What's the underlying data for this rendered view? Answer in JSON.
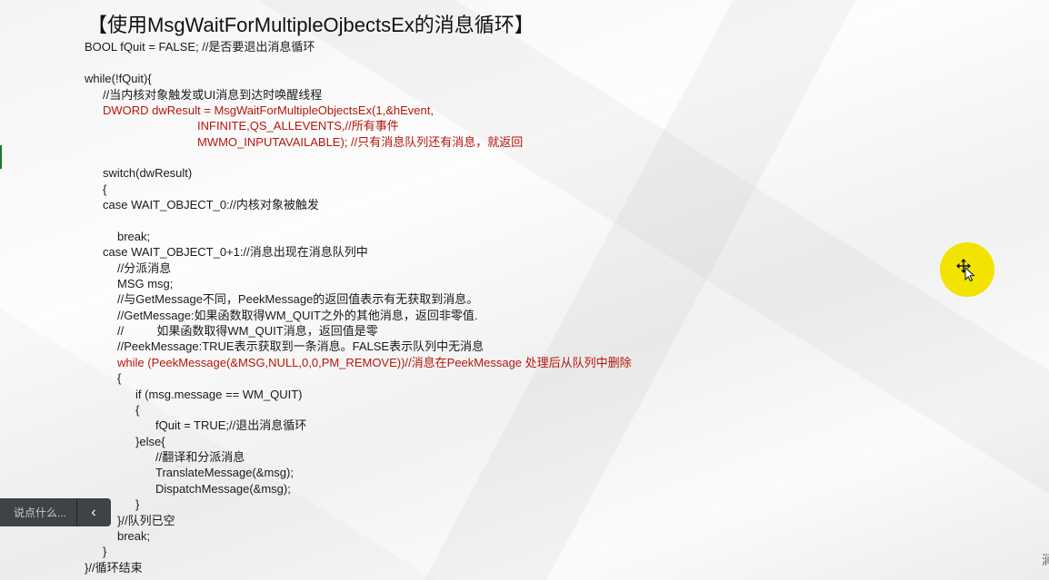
{
  "slide": {
    "title": "【使用MsgWaitForMultipleOjbectsEx的消息循环】"
  },
  "code_lines": [
    {
      "text": "BOOL fQuit = FALSE; //是否要退出消息循环",
      "color": "black"
    },
    {
      "text": "while(!fQuit){",
      "color": "black"
    },
    {
      "text": "//当内核对象触发或UI消息到达时唤醒线程",
      "color": "black"
    },
    {
      "text": "DWORD dwResult = MsgWaitForMultipleObjectsEx(1,&hEvent,",
      "color": "red"
    },
    {
      "text": "INFINITE,QS_ALLEVENTS,//所有事件",
      "color": "red"
    },
    {
      "text": "MWMO_INPUTAVAILABLE); //只有消息队列还有消息，就返回",
      "color": "red"
    },
    {
      "text": "switch(dwResult)",
      "color": "black"
    },
    {
      "text": "{",
      "color": "black"
    },
    {
      "text": "case WAIT_OBJECT_0://内核对象被触发",
      "color": "black"
    },
    {
      "text": "break;",
      "color": "black"
    },
    {
      "text": "case WAIT_OBJECT_0+1://消息出现在消息队列中",
      "color": "black"
    },
    {
      "text": "//分派消息",
      "color": "black"
    },
    {
      "text": "MSG msg;",
      "color": "black"
    },
    {
      "text": "//与GetMessage不同，PeekMessage的返回值表示有无获取到消息。",
      "color": "black"
    },
    {
      "text": "//GetMessage:如果函数取得WM_QUIT之外的其他消息，返回非零值.",
      "color": "black"
    },
    {
      "text": "//          如果函数取得WM_QUIT消息，返回值是零",
      "color": "black"
    },
    {
      "text": "//PeekMessage:TRUE表示获取到一条消息。FALSE表示队列中无消息",
      "color": "black"
    },
    {
      "text": "while (PeekMessage(&MSG,NULL,0,0,PM_REMOVE))//消息在PeekMessage 处理后从队列中删除",
      "color": "red"
    },
    {
      "text": "{",
      "color": "black"
    },
    {
      "text": "if (msg.message == WM_QUIT)",
      "color": "black"
    },
    {
      "text": "{",
      "color": "black"
    },
    {
      "text": "fQuit = TRUE;//退出消息循环",
      "color": "black"
    },
    {
      "text": "}else{",
      "color": "black"
    },
    {
      "text": "//翻译和分派消息",
      "color": "black"
    },
    {
      "text": "TranslateMessage(&msg);",
      "color": "black"
    },
    {
      "text": "DispatchMessage(&msg);",
      "color": "black"
    },
    {
      "text": "}",
      "color": "black"
    },
    {
      "text": "}//队列已空",
      "color": "black"
    },
    {
      "text": "break;",
      "color": "black"
    },
    {
      "text": "}",
      "color": "black"
    },
    {
      "text": "}//循环结束",
      "color": "black"
    }
  ],
  "comment_bar": {
    "placeholder": "说点什么...",
    "collapse_glyph": "‹"
  },
  "corner_glyph": "涧",
  "colors": {
    "code_red": "#b5170e",
    "code_black": "#1a1a1a",
    "cursor_highlight": "#f2e300",
    "comment_bar_bg": "#3f4347"
  },
  "icons": {
    "cursor": "move-cursor-icon",
    "collapse": "chevron-left-icon"
  }
}
